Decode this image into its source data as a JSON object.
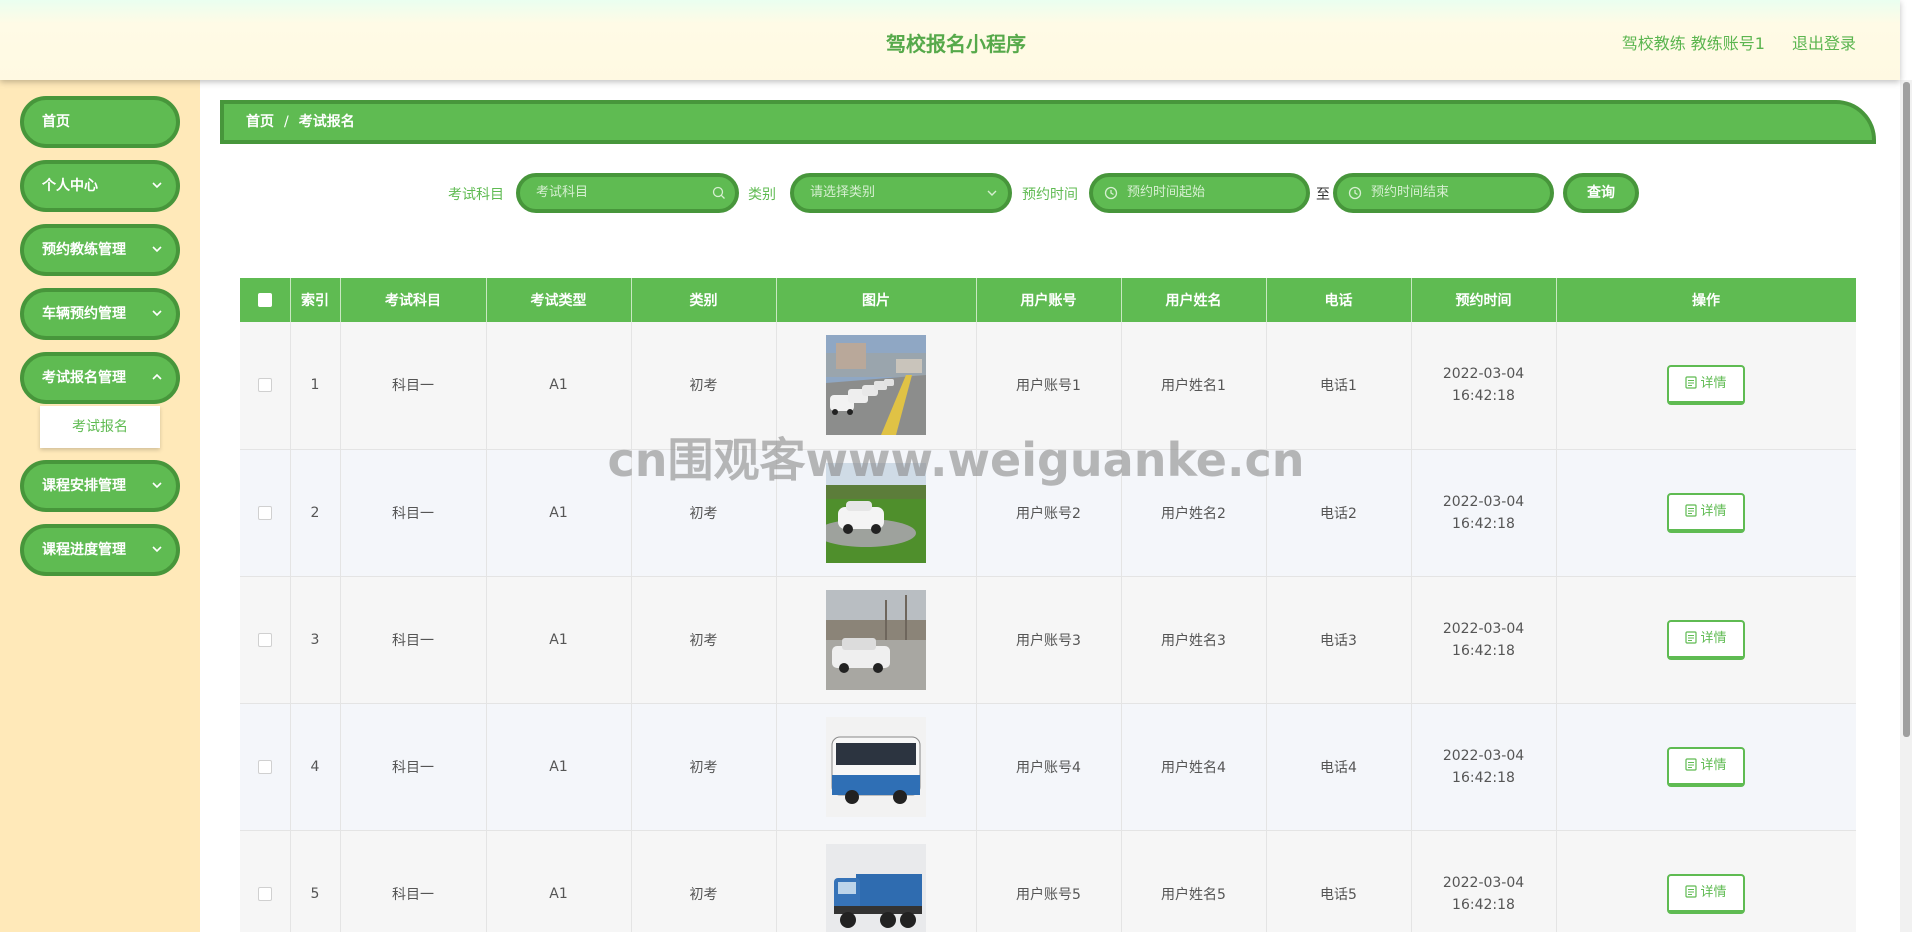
{
  "header": {
    "title": "驾校报名小程序",
    "user": "驾校教练 教练账号1",
    "logout": "退出登录"
  },
  "sidebar": {
    "items": [
      {
        "label": "首页",
        "has_children": false
      },
      {
        "label": "个人中心",
        "has_children": true
      },
      {
        "label": "预约教练管理",
        "has_children": true
      },
      {
        "label": "车辆预约管理",
        "has_children": true
      },
      {
        "label": "考试报名管理",
        "has_children": true
      },
      {
        "label": "课程安排管理",
        "has_children": true
      },
      {
        "label": "课程进度管理",
        "has_children": true
      }
    ],
    "active_submenu": "考试报名"
  },
  "breadcrumb": {
    "home": "首页",
    "separator": "/",
    "current": "考试报名"
  },
  "filters": {
    "subject_label": "考试科目",
    "subject_placeholder": "考试科目",
    "category_label": "类别",
    "category_placeholder": "请选择类别",
    "time_label": "预约时间",
    "start_placeholder": "预约时间起始",
    "to": "至",
    "end_placeholder": "预约时间结束",
    "query_button": "查询"
  },
  "table": {
    "headers": [
      "索引",
      "考试科目",
      "考试类型",
      "类别",
      "图片",
      "用户账号",
      "用户姓名",
      "电话",
      "预约时间",
      "操作"
    ],
    "rows": [
      {
        "index": "1",
        "subject": "科目一",
        "type": "A1",
        "category": "初考",
        "image": "driving-school-cars",
        "account": "用户账号1",
        "name": "用户姓名1",
        "phone": "电话1",
        "time": "2022-03-04 16:42:18",
        "action": "详情"
      },
      {
        "index": "2",
        "subject": "科目一",
        "type": "A1",
        "category": "初考",
        "image": "white-car-on-grass",
        "account": "用户账号2",
        "name": "用户姓名2",
        "phone": "电话2",
        "time": "2022-03-04 16:42:18",
        "action": "详情"
      },
      {
        "index": "3",
        "subject": "科目一",
        "type": "A1",
        "category": "初考",
        "image": "white-sedan-trees",
        "account": "用户账号3",
        "name": "用户姓名3",
        "phone": "电话3",
        "time": "2022-03-04 16:42:18",
        "action": "详情"
      },
      {
        "index": "4",
        "subject": "科目一",
        "type": "A1",
        "category": "初考",
        "image": "blue-white-bus",
        "account": "用户账号4",
        "name": "用户姓名4",
        "phone": "电话4",
        "time": "2022-03-04 16:42:18",
        "action": "详情"
      },
      {
        "index": "5",
        "subject": "科目一",
        "type": "A1",
        "category": "初考",
        "image": "blue-truck",
        "account": "用户账号5",
        "name": "用户姓名5",
        "phone": "电话5",
        "time": "2022-03-04 16:42:18",
        "action": "详情"
      }
    ]
  },
  "watermark": "cn围观客www.weiguanke.cn",
  "colors": {
    "primary": "#5fbb52",
    "primary_border": "#47963b",
    "sidebar_bg": "#ffe9b9",
    "header_bg": "#fff9e2"
  }
}
